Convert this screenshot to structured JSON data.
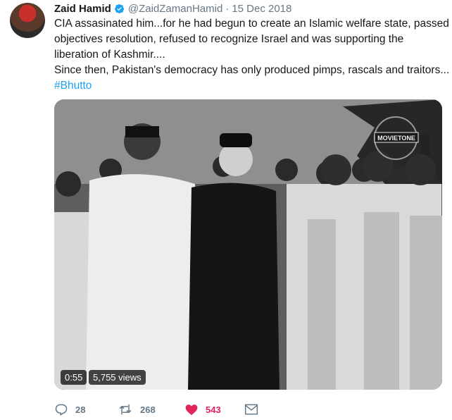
{
  "tweet": {
    "author_name": "Zaid Hamid",
    "handle": "@ZaidZamanHamid",
    "separator": "·",
    "date": "15 Dec 2018",
    "verified_icon": "verified-badge-icon",
    "text_lines": [
      "CIA assasinated him...for he had begun to create an Islamic welfare state, passed",
      "objectives resolution, refused to recognize Israel and was supporting the",
      "liberation of Kashmir....",
      "Since then, Pakistan's democracy has only produced pimps, rascals and traitors..."
    ],
    "hashtag": "#Bhutto"
  },
  "video": {
    "watermark": "MOVIETONE",
    "duration": "0:55",
    "views": "5,755 views"
  },
  "actions": {
    "reply_count": "28",
    "retweet_count": "268",
    "like_count": "543"
  },
  "colors": {
    "link": "#1da1f2",
    "muted": "#657786",
    "like": "#e0245e"
  }
}
